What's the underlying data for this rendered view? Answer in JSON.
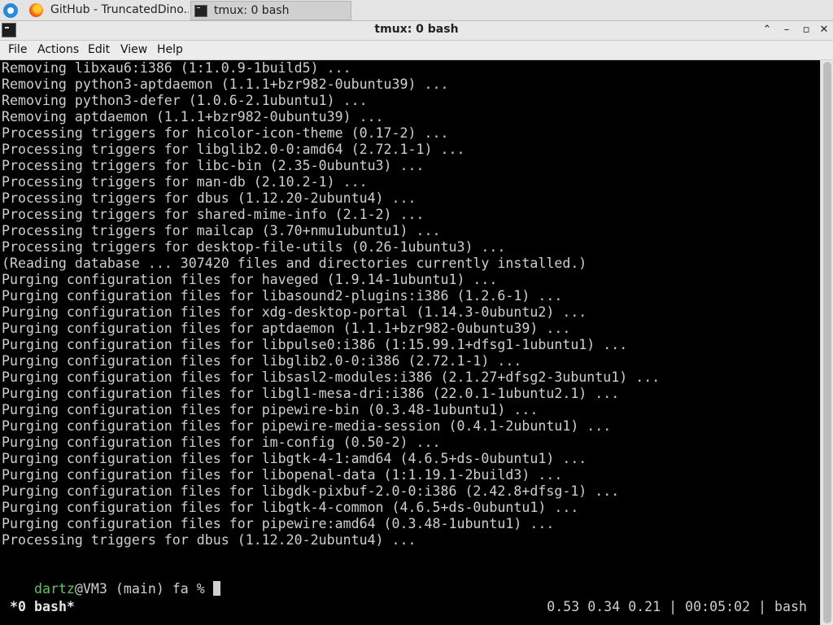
{
  "taskbar": {
    "tasks": [
      {
        "label": "GitHub - TruncatedDino...",
        "icon": "firefox-icon"
      },
      {
        "label": "tmux: 0 bash",
        "icon": "terminal-icon"
      }
    ]
  },
  "window": {
    "title": "tmux: 0 bash",
    "controls": {
      "restore": "⌃",
      "minimize": "–",
      "maximize": "▫",
      "close": "✕"
    }
  },
  "menubar": {
    "items": [
      "File",
      "Actions",
      "Edit",
      "View",
      "Help"
    ]
  },
  "terminal": {
    "lines": [
      "Removing libxau6:i386 (1:1.0.9-1build5) ...",
      "Removing python3-aptdaemon (1.1.1+bzr982-0ubuntu39) ...",
      "Removing python3-defer (1.0.6-2.1ubuntu1) ...",
      "Removing aptdaemon (1.1.1+bzr982-0ubuntu39) ...",
      "Processing triggers for hicolor-icon-theme (0.17-2) ...",
      "Processing triggers for libglib2.0-0:amd64 (2.72.1-1) ...",
      "Processing triggers for libc-bin (2.35-0ubuntu3) ...",
      "Processing triggers for man-db (2.10.2-1) ...",
      "Processing triggers for dbus (1.12.20-2ubuntu4) ...",
      "Processing triggers for shared-mime-info (2.1-2) ...",
      "Processing triggers for mailcap (3.70+nmu1ubuntu1) ...",
      "Processing triggers for desktop-file-utils (0.26-1ubuntu3) ...",
      "(Reading database ... 307420 files and directories currently installed.)",
      "Purging configuration files for haveged (1.9.14-1ubuntu1) ...",
      "Purging configuration files for libasound2-plugins:i386 (1.2.6-1) ...",
      "Purging configuration files for xdg-desktop-portal (1.14.3-0ubuntu2) ...",
      "Purging configuration files for aptdaemon (1.1.1+bzr982-0ubuntu39) ...",
      "Purging configuration files for libpulse0:i386 (1:15.99.1+dfsg1-1ubuntu1) ...",
      "Purging configuration files for libglib2.0-0:i386 (2.72.1-1) ...",
      "Purging configuration files for libsasl2-modules:i386 (2.1.27+dfsg2-3ubuntu1) ...",
      "Purging configuration files for libgl1-mesa-dri:i386 (22.0.1-1ubuntu2.1) ...",
      "Purging configuration files for pipewire-bin (0.3.48-1ubuntu1) ...",
      "Purging configuration files for pipewire-media-session (0.4.1-2ubuntu1) ...",
      "Purging configuration files for im-config (0.50-2) ...",
      "Purging configuration files for libgtk-4-1:amd64 (4.6.5+ds-0ubuntu1) ...",
      "Purging configuration files for libopenal-data (1:1.19.1-2build3) ...",
      "Purging configuration files for libgdk-pixbuf-2.0-0:i386 (2.42.8+dfsg-1) ...",
      "Purging configuration files for libgtk-4-common (4.6.5+ds-0ubuntu1) ...",
      "Purging configuration files for pipewire:amd64 (0.3.48-1ubuntu1) ...",
      "Processing triggers for dbus (1.12.20-2ubuntu4) ..."
    ],
    "prompt": {
      "user": "dartz",
      "rest": "@VM3 (main) fa % "
    },
    "status": {
      "left": "*0 bash*",
      "right": "0.53 0.34 0.21 | 00:05:02 | bash"
    }
  },
  "colors": {
    "terminal_bg": "#000000",
    "terminal_fg": "#cfcfcf",
    "prompt_user": "#5ec45e"
  }
}
